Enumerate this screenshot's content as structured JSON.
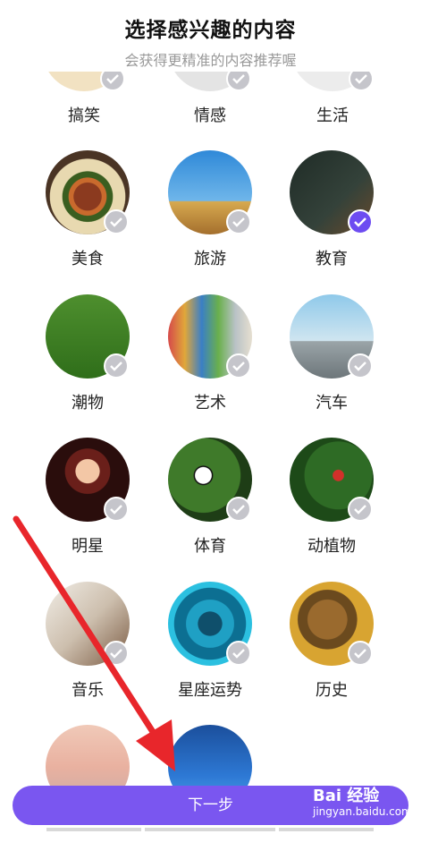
{
  "header": {
    "title": "选择感兴趣的内容",
    "subtitle": "会获得更精准的内容推荐喔"
  },
  "categories": [
    {
      "label": "搞笑",
      "icon": "funny-thumbnail",
      "selected": false
    },
    {
      "label": "情感",
      "icon": "emotion-thumbnail",
      "selected": false
    },
    {
      "label": "生活",
      "icon": "life-thumbnail",
      "selected": false
    },
    {
      "label": "美食",
      "icon": "food-thumbnail",
      "selected": false
    },
    {
      "label": "旅游",
      "icon": "travel-thumbnail",
      "selected": false
    },
    {
      "label": "教育",
      "icon": "education-thumbnail",
      "selected": true
    },
    {
      "label": "潮物",
      "icon": "trend-thumbnail",
      "selected": false
    },
    {
      "label": "艺术",
      "icon": "art-thumbnail",
      "selected": false
    },
    {
      "label": "汽车",
      "icon": "car-thumbnail",
      "selected": false
    },
    {
      "label": "明星",
      "icon": "star-thumbnail",
      "selected": false
    },
    {
      "label": "体育",
      "icon": "sport-thumbnail",
      "selected": false
    },
    {
      "label": "动植物",
      "icon": "nature-thumbnail",
      "selected": false
    },
    {
      "label": "音乐",
      "icon": "music-thumbnail",
      "selected": false
    },
    {
      "label": "星座运势",
      "icon": "zodiac-thumbnail",
      "selected": false
    },
    {
      "label": "历史",
      "icon": "history-thumbnail",
      "selected": false
    },
    {
      "label": "",
      "icon": "military-thumbnail",
      "selected": false
    },
    {
      "label": "",
      "icon": "people-thumbnail",
      "selected": false
    }
  ],
  "next_button": {
    "label": "下一步"
  },
  "watermark": {
    "brand": "Bai 经验",
    "url": "jingyan.baidu.com"
  },
  "colors": {
    "accent": "#7a56f0",
    "check_on": "#6d4cf1",
    "check_off": "#c5c5cb",
    "arrow": "#e8262b"
  }
}
